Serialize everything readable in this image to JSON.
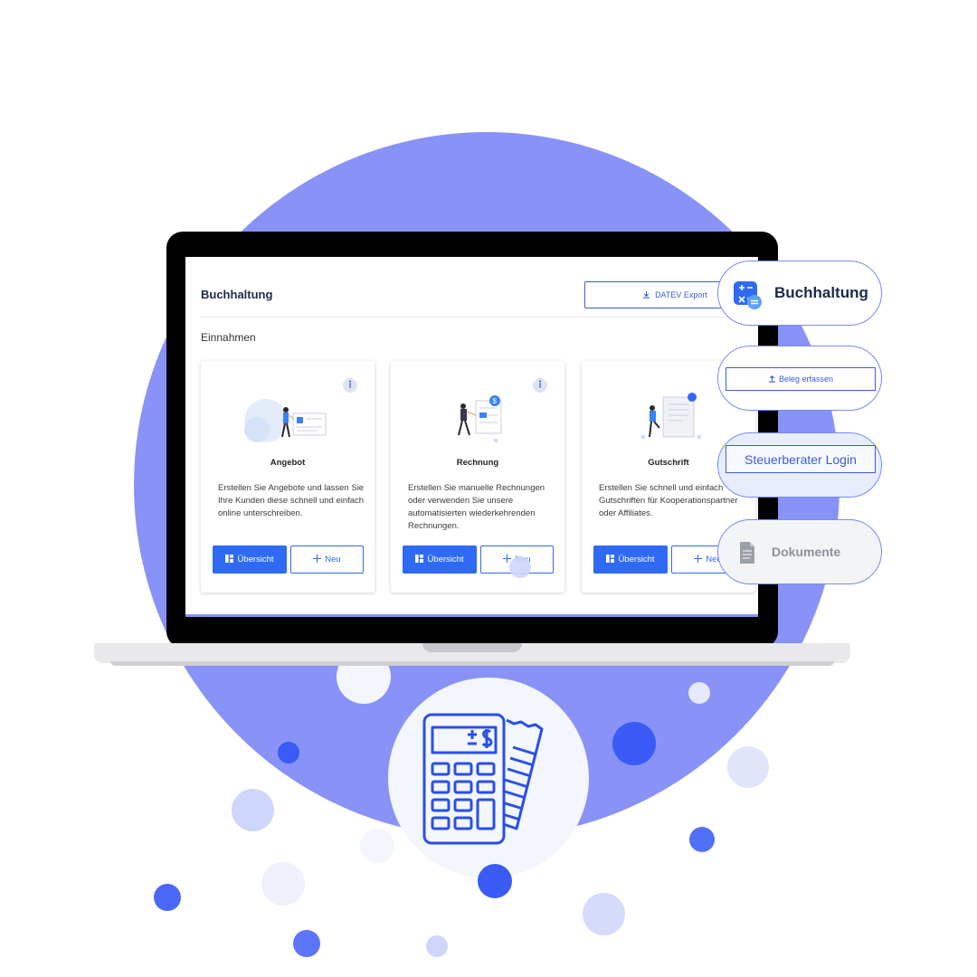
{
  "app": {
    "title": "Buchhaltung",
    "datev_export_label": "DATEV Export",
    "section_title": "Einnahmen"
  },
  "cards": [
    {
      "title": "Angebot",
      "description": "Erstellen Sie Angebote und lassen Sie Ihre Kunden diese schnell und einfach online unterschreiben.",
      "overview_label": "Übersicht",
      "new_label": "Neu"
    },
    {
      "title": "Rechnung",
      "description": "Erstellen Sie manuelle Rechnungen oder verwenden Sie unsere automatisierten wiederkehrenden Rechnungen.",
      "overview_label": "Übersicht",
      "new_label": "Neu"
    },
    {
      "title": "Gutschrift",
      "description": "Erstellen Sie schnell und einfach Gutschriften für Kooperationspartner oder Affiliates.",
      "overview_label": "Übersicht",
      "new_label": "Neu"
    }
  ],
  "floating_menu": {
    "buchhaltung_label": "Buchhaltung",
    "beleg_label": "Beleg erfassen",
    "steuerberater_label": "Steuerberater Login",
    "dokumente_label": "Dokumente"
  },
  "colors": {
    "primary": "#2f6af5",
    "circle": "#8892f7",
    "title_dark": "#1c2a4a"
  },
  "icons": {
    "export": "download-icon",
    "overview": "grid-icon",
    "new": "plus-icon",
    "menu": "more-vertical-icon",
    "accounting": "calculator-icon",
    "upload": "upload-icon",
    "document": "document-icon"
  }
}
